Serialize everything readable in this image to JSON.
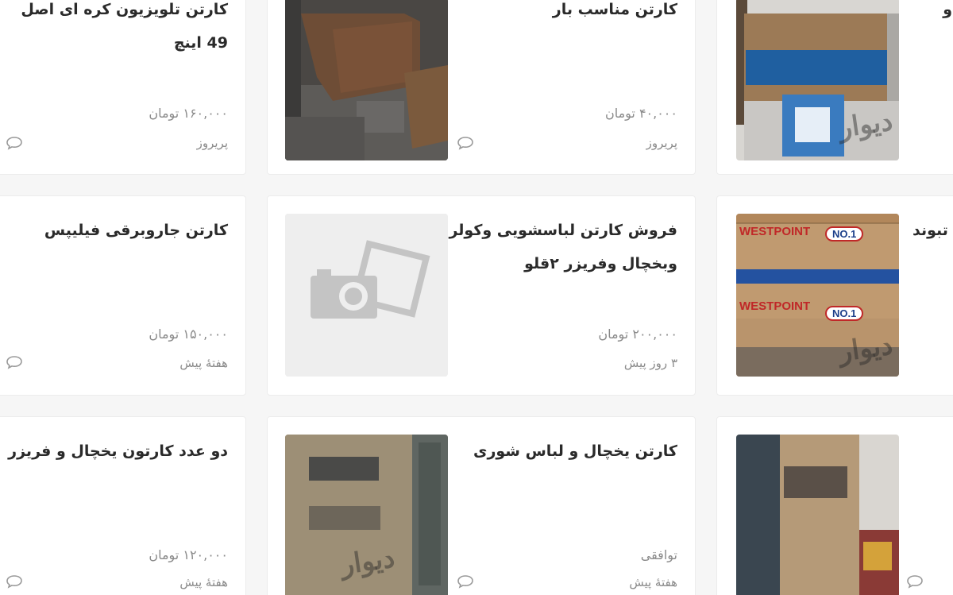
{
  "listings": [
    {
      "title_line1": "کارتن تلویزیون کره ای اصل",
      "title_line2": "49 اینچ",
      "price": "۱۶۰,۰۰۰ تومان",
      "time": "پریروز"
    },
    {
      "title_line1": "کارتن مناسب بار",
      "title_line2": "",
      "price": "۴۰,۰۰۰ تومان",
      "time": "پریروز"
    },
    {
      "title_line1": "کارتن جاروبرقی فیلیپس",
      "title_line2": "",
      "price": "۱۵۰,۰۰۰ تومان",
      "time": "هفتهٔ پیش"
    },
    {
      "title_line1": "فروش کارتن لباسشویی وکولر",
      "title_line2": "وبخچال وفریزر ۲قلو",
      "price": "۲۰۰,۰۰۰ تومان",
      "time": "۳ روز پیش"
    },
    {
      "title_line1": "دو عدد کارتون یخچال و فریزر",
      "title_line2": "",
      "price": "۱۲۰,۰۰۰ تومان",
      "time": "هفتهٔ پیش"
    },
    {
      "title_line1": "کارتن یخچال و لباس شوری",
      "title_line2": "",
      "price": "توافقی",
      "time": "هفتهٔ پیش"
    }
  ],
  "edge_texts": {
    "right_row1": "و",
    "right_row2": "تبوند"
  },
  "watermark": "دیوار",
  "photo_labels": {
    "brand": "WESTPOINT",
    "badge": "NO.1"
  },
  "colors": {
    "title": "#2a2a2a",
    "meta": "#8a8a8a",
    "border": "#ececec",
    "placeholder_bg": "#eeeeee"
  }
}
